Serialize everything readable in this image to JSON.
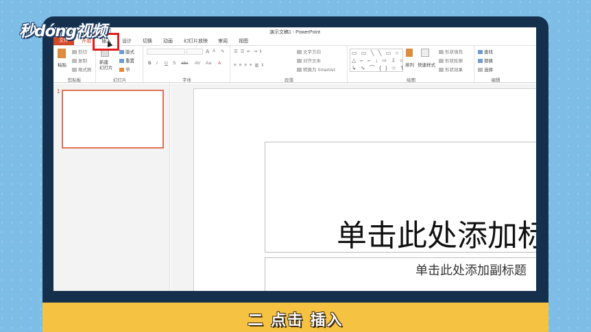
{
  "watermark": "秒dóng视频",
  "window_title": "演示文稿1 - PowerPoint",
  "tabs": {
    "file": "文件",
    "home": "开始",
    "insert": "插入",
    "design": "设计",
    "transitions": "切换",
    "animations": "动画",
    "slideshow": "幻灯片放映",
    "review": "审阅",
    "view": "视图"
  },
  "ribbon": {
    "clipboard": {
      "label": "剪贴板",
      "paste": "粘贴",
      "cut": "剪切",
      "copy": "复制",
      "format_painter": "格式刷"
    },
    "slides": {
      "label": "幻灯片",
      "new_slide": "新建\n幻灯片",
      "layout": "版式",
      "reset": "重置",
      "section": "节"
    },
    "font": {
      "label": "字体",
      "bold": "B",
      "italic": "I",
      "underline": "U",
      "strike": "S",
      "spacing": "abc",
      "case": "Aa",
      "grow": "A",
      "shrink": "A"
    },
    "paragraph": {
      "label": "段落",
      "text_direction": "文字方向",
      "align_text": "对齐文本",
      "smartart": "转换为 SmartArt"
    },
    "drawing": {
      "label": "绘图",
      "arrange": "排列",
      "quick_styles": "快速样式",
      "shape_fill": "形状填充",
      "shape_outline": "形状轮廓",
      "shape_effects": "形状效果",
      "shapes_glyphs": "▭ ▭ ╲ ╲ ▭ ○ ▭\n△ ⌐ ⌐ ↓ ⇨ ⇩ ⇦\n↳ ∿ ⌒ { } ☆ ⇅"
    },
    "editing": {
      "label": "编辑",
      "find": "查找",
      "replace": "替换",
      "select": "选择"
    }
  },
  "thumbnail": {
    "number": "1"
  },
  "slide": {
    "title_placeholder": "单击此处添加标题",
    "subtitle_placeholder": "单击此处添加副标题"
  },
  "caption": "二 点击 插入",
  "colors": {
    "accent": "#d24726",
    "highlight": "#e21b1b",
    "caption_bar": "#f6c242",
    "bezel": "#14304d",
    "background": "#7ebde6"
  }
}
